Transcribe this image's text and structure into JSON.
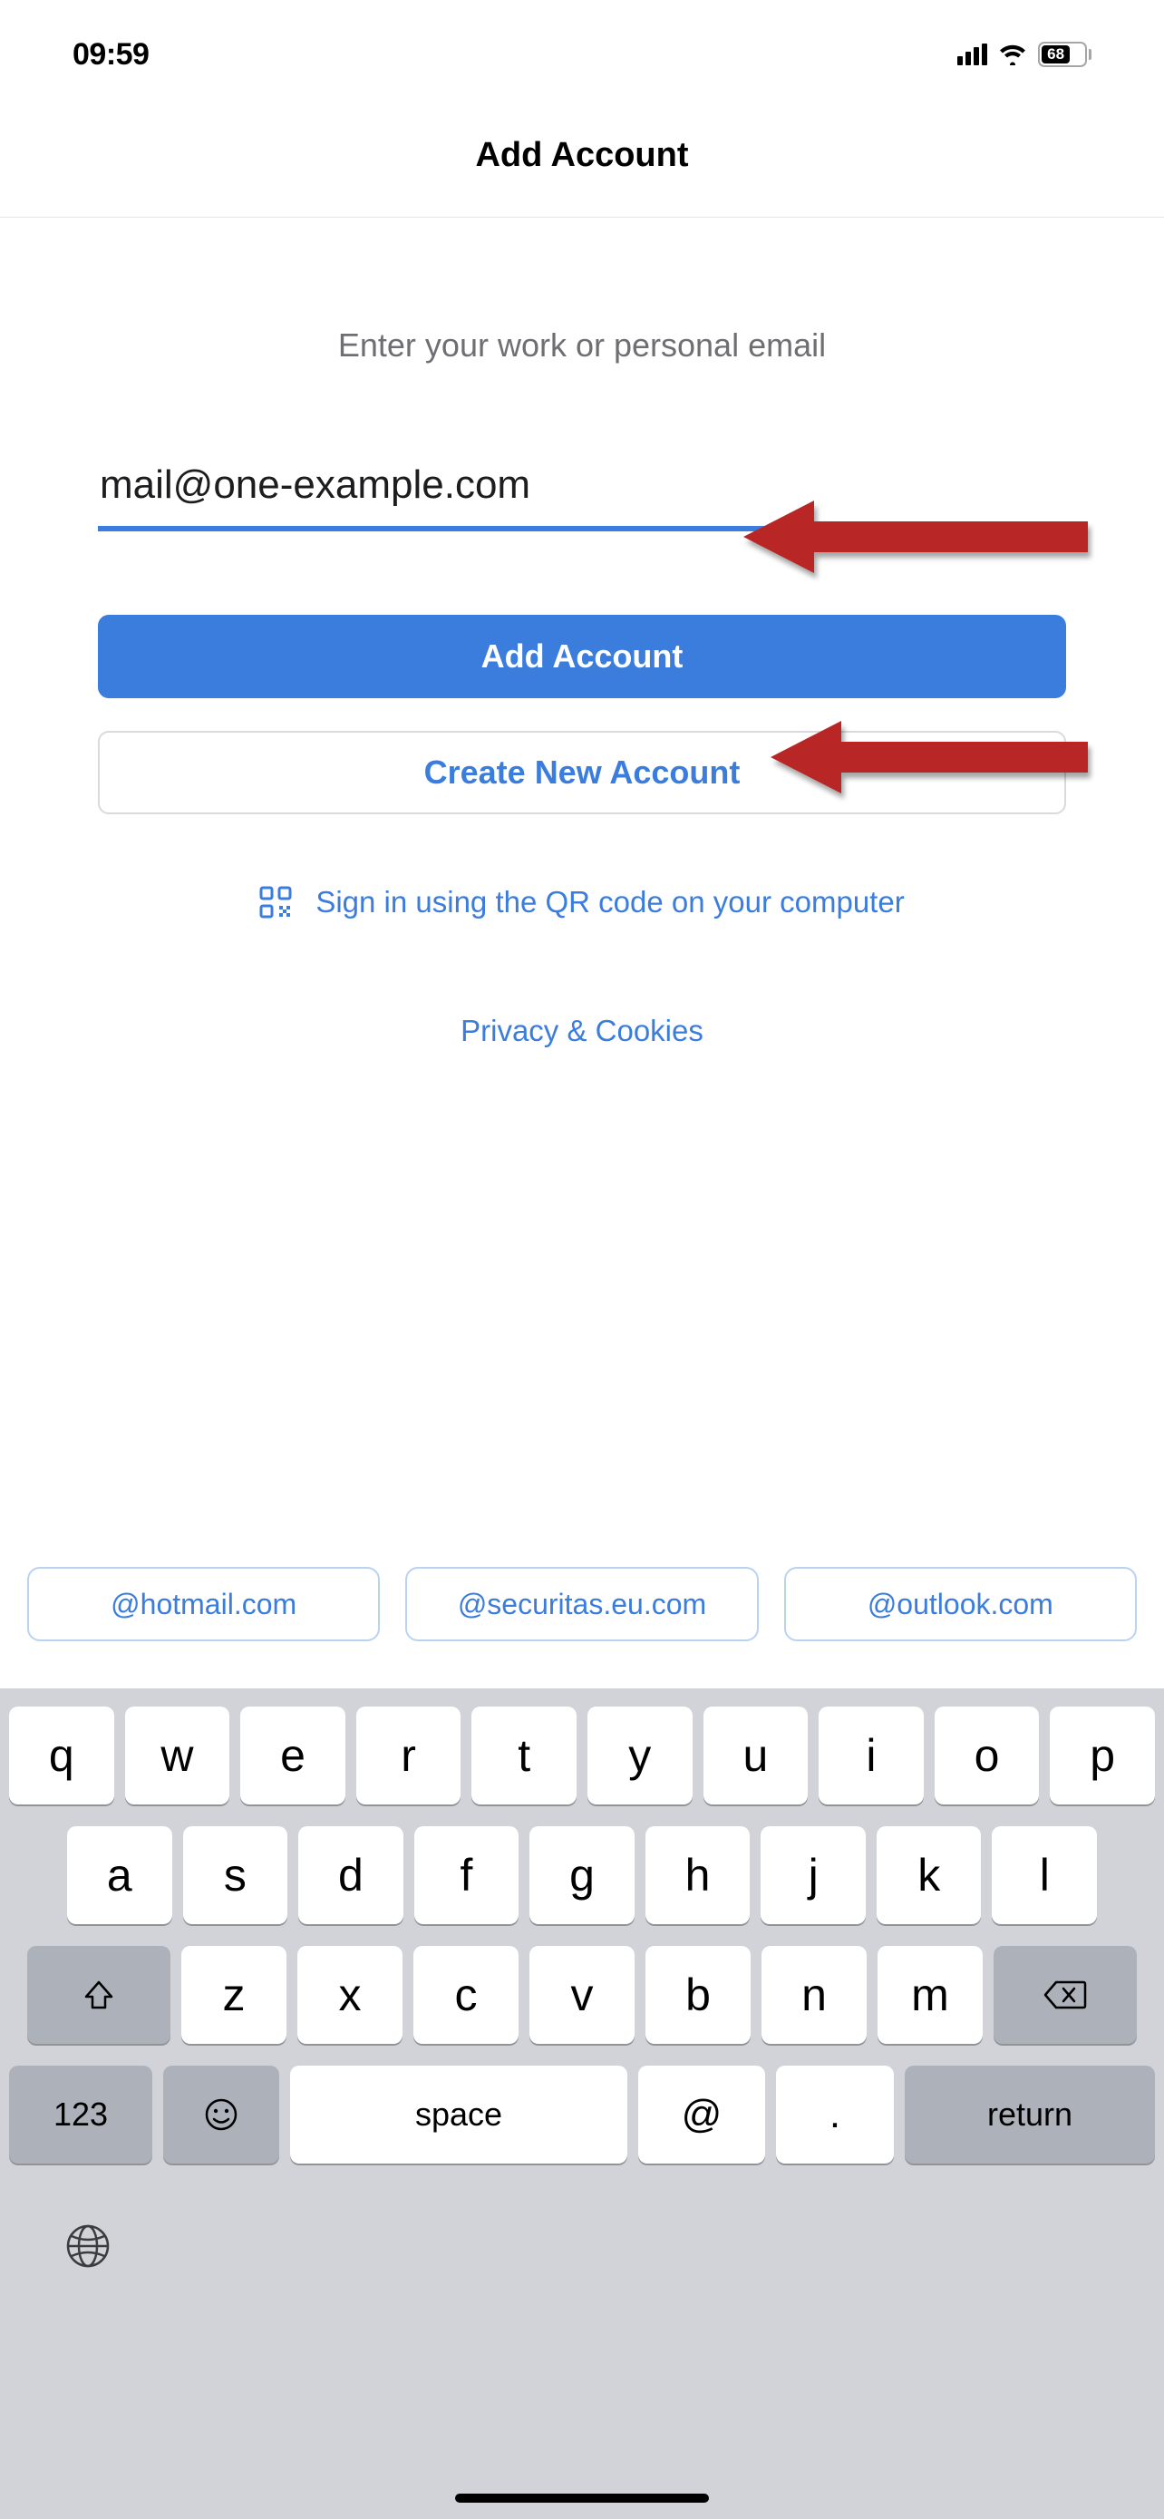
{
  "status": {
    "time": "09:59",
    "battery": "68"
  },
  "header": {
    "title": "Add Account"
  },
  "content": {
    "prompt": "Enter your work or personal email",
    "email_value": "mail@one-example.com",
    "add_button": "Add Account",
    "create_button": "Create New Account",
    "qr_text": "Sign in using the QR code on your computer",
    "privacy": "Privacy & Cookies"
  },
  "suggestions": [
    "@hotmail.com",
    "@securitas.eu.com",
    "@outlook.com"
  ],
  "keyboard": {
    "row1": [
      "q",
      "w",
      "e",
      "r",
      "t",
      "y",
      "u",
      "i",
      "o",
      "p"
    ],
    "row2": [
      "a",
      "s",
      "d",
      "f",
      "g",
      "h",
      "j",
      "k",
      "l"
    ],
    "row3": [
      "z",
      "x",
      "c",
      "v",
      "b",
      "n",
      "m"
    ],
    "numbers": "123",
    "space": "space",
    "at": "@",
    "dot": ".",
    "return": "return"
  }
}
